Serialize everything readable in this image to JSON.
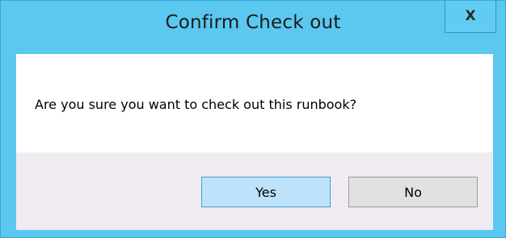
{
  "dialog": {
    "title": "Confirm Check out",
    "close_label": "X",
    "message": "Are you sure you want to check out this runbook?",
    "buttons": {
      "yes_label": "Yes",
      "no_label": "No"
    }
  },
  "colors": {
    "title_bar": "#5bc8f0",
    "content_bg": "#ffffff",
    "footer_bg": "#f0ecf2",
    "default_button_bg": "#bde3fb",
    "default_button_border": "#3c9bd6",
    "button_bg": "#e1e1e1"
  },
  "icons": {
    "close": "close-icon"
  }
}
